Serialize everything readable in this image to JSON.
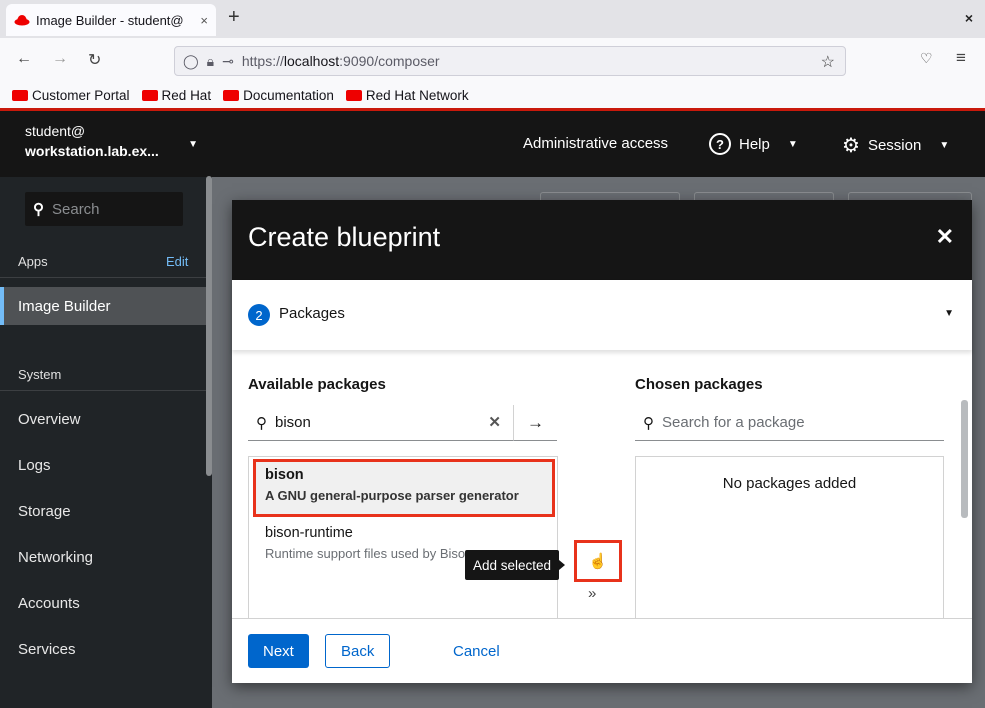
{
  "browser": {
    "tab_title": "Image Builder - student@",
    "tab_close": "×",
    "new_tab": "+",
    "window_close": "×",
    "url_prefix": "https://",
    "url_host": "localhost",
    "url_rest": ":9090/composer",
    "bookmarks": [
      "Customer Portal",
      "Red Hat",
      "Documentation",
      "Red Hat Network"
    ]
  },
  "cockpit": {
    "host_user": "student@",
    "host_name": "workstation.lab.ex...",
    "search_placeholder": "Search",
    "apps_label": "Apps",
    "edit_label": "Edit",
    "active_app": "Image Builder",
    "system_label": "System",
    "nav_items": [
      "Overview",
      "Logs",
      "Storage",
      "Networking",
      "Accounts",
      "Services"
    ],
    "admin_access": "Administrative access",
    "help_label": "Help",
    "session_label": "Session"
  },
  "modal": {
    "title": "Create blueprint",
    "step_number": "2",
    "step_label": "Packages",
    "available_header": "Available packages",
    "chosen_header": "Chosen packages",
    "filter_value": "bison",
    "chosen_placeholder": "Search for a package",
    "packages": [
      {
        "name": "bison",
        "description": "A GNU general-purpose parser generator"
      },
      {
        "name": "bison-runtime",
        "description": "Runtime support files used by Bison"
      }
    ],
    "no_packages": "No packages added",
    "tooltip": "Add selected",
    "buttons": {
      "next": "Next",
      "back": "Back",
      "cancel": "Cancel"
    }
  }
}
